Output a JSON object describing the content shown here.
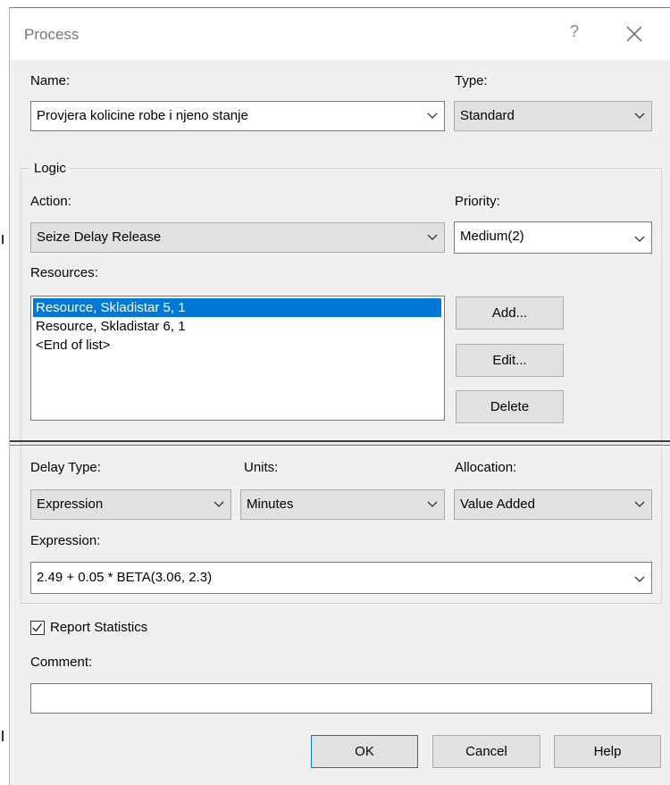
{
  "window": {
    "title": "Process",
    "help_glyph": "?",
    "close_icon": "close-icon"
  },
  "name": {
    "label": "Name:",
    "value": "Provjera kolicine robe i njeno stanje"
  },
  "type": {
    "label": "Type:",
    "value": "Standard"
  },
  "logic": {
    "group_label": "Logic",
    "action_label": "Action:",
    "action_value": "Seize Delay Release",
    "priority_label": "Priority:",
    "priority_value": "Medium(2)",
    "resources_label": "Resources:",
    "resources": [
      "Resource, Skladistar 5, 1",
      "Resource, Skladistar 6, 1",
      "<End of list>"
    ],
    "selected_resource_index": 0,
    "buttons": {
      "add": "Add...",
      "edit": "Edit...",
      "delete": "Delete"
    },
    "delay_type_label": "Delay Type:",
    "delay_type_value": "Expression",
    "units_label": "Units:",
    "units_value": "Minutes",
    "allocation_label": "Allocation:",
    "allocation_value": "Value Added",
    "expression_label": "Expression:",
    "expression_value": "2.49 + 0.05 * BETA(3.06, 2.3)"
  },
  "report_statistics": {
    "label": "Report Statistics",
    "checked": true
  },
  "comment": {
    "label": "Comment:",
    "value": ""
  },
  "footer": {
    "ok": "OK",
    "cancel": "Cancel",
    "help": "Help"
  },
  "colors": {
    "selection": "#0078d7",
    "dialog_bg": "#f0f0f0",
    "button_bg": "#e1e1e1"
  }
}
